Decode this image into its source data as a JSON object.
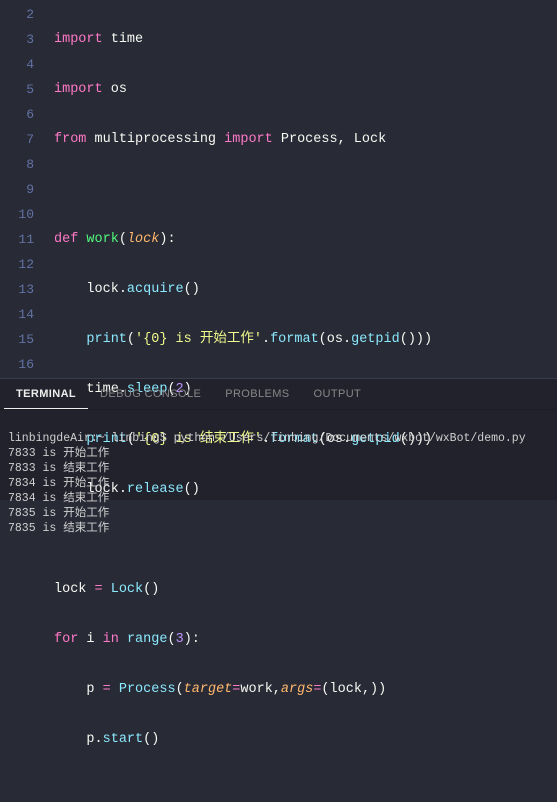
{
  "gutter": [
    "2",
    "3",
    "4",
    "5",
    "6",
    "7",
    "8",
    "9",
    "10",
    "11",
    "12",
    "13",
    "14",
    "15",
    "16"
  ],
  "tokens": {
    "import": "import",
    "from": "from",
    "def": "def",
    "for": "for",
    "in": "in",
    "time": "time",
    "os": "os",
    "multiprocessing": "multiprocessing",
    "Process": "Process",
    "Lock": "Lock",
    "work": "work",
    "lock": "lock",
    "acquire": "acquire",
    "print": "print",
    "format": "format",
    "getpid": "getpid",
    "sleep": "sleep",
    "release": "release",
    "range": "range",
    "target": "target",
    "args": "args",
    "start": "start",
    "i": "i",
    "p": "p",
    "str1": "'{0} is 开始工作'",
    "str2": "'{0} is 结束工作'",
    "n2": "2",
    "n3": "3",
    "eq": "=",
    "comma": ", ",
    "comma_nb": ",",
    "colon": ":",
    "lp": "(",
    "rp": ")",
    "dot": "."
  },
  "tabs": {
    "terminal": "TERMINAL",
    "debug": "DEBUG CONSOLE",
    "problems": "PROBLEMS",
    "output": "OUTPUT"
  },
  "terminal": {
    "prompt": "linbingdeAir:~ linbing$ ",
    "cmd": "python /Users/linbing/Documents/wxbot/wxBot/demo.py",
    "lines": [
      "7833 is 开始工作",
      "7833 is 结束工作",
      "7834 is 开始工作",
      "7834 is 结束工作",
      "7835 is 开始工作",
      "7835 is 结束工作"
    ]
  }
}
